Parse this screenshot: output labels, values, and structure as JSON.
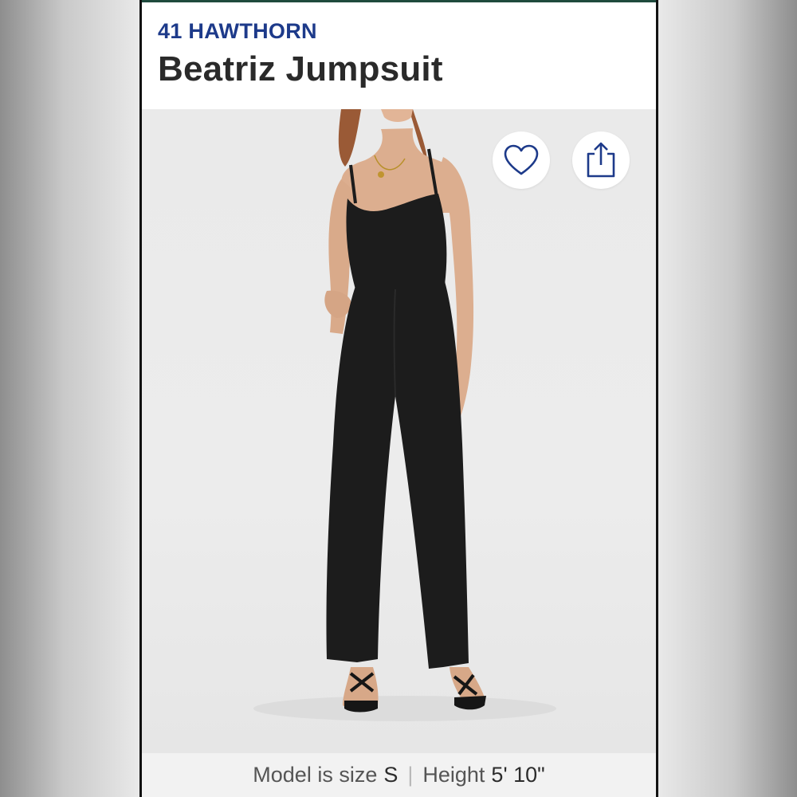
{
  "product": {
    "brand": "41 HAWTHORN",
    "name": "Beatriz Jumpsuit"
  },
  "gallery": {
    "image_alt": "Model wearing black jumpsuit",
    "wishlist_icon": "heart-outline-icon",
    "share_icon": "share-upload-icon"
  },
  "model_info": {
    "size_label": "Model is size",
    "size_value": "S",
    "separator": "|",
    "height_label": "Height",
    "height_value": "5' 10\""
  },
  "colors": {
    "brand": "#1d3a8a",
    "title": "#2a2a2a",
    "garment": "#1c1c1c",
    "icon": "#1d3a8a"
  }
}
